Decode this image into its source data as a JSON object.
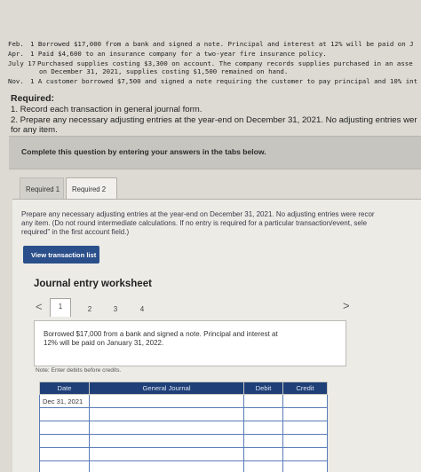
{
  "problem_lines": [
    {
      "label": "Feb.",
      "text": "1 Borrowed $17,000 from a bank and signed a note. Principal and interest at 12% will be paid on J"
    },
    {
      "label": "Apr.",
      "text": "1 Paid $4,600 to an insurance company for a two-year fire insurance policy."
    },
    {
      "label": "July 17",
      "text": "Purchased supplies costing $3,300 on account. The company records supplies purchased in an asse"
    },
    {
      "label": "",
      "text": "on December 31, 2021, supplies costing $1,500 remained on hand."
    },
    {
      "label": "Nov.",
      "text": "1 A customer borrowed $7,500 and signed a note requiring the customer to pay principal and 10% int"
    }
  ],
  "required": {
    "title": "Required:",
    "item1": "1. Record each transaction in general journal form.",
    "item2a": "2. Prepare any necessary adjusting entries at the year-end on December 31, 2021. No adjusting entries wer",
    "item2b": "for any item."
  },
  "banner": "Complete this question by entering your answers in the tabs below.",
  "tabs": [
    {
      "label": "Required 1"
    },
    {
      "label": "Required 2"
    }
  ],
  "instructions": [
    "Prepare any necessary adjusting entries at the year-end on December 31, 2021. No adjusting entries were recor",
    "any item. (Do not round intermediate calculations. If no entry is required for a particular transaction/event, sele",
    "required\" in the first account field.)"
  ],
  "view_button": "View transaction list",
  "worksheet": {
    "title": "Journal entry worksheet",
    "prev_arrow": "<",
    "next_arrow": ">",
    "pages": [
      "1",
      "2",
      "3",
      "4"
    ],
    "active_page": 1,
    "description": [
      "Borrowed $17,000 from a bank and signed a note. Principal and interest at",
      "12% will be paid on January 31, 2022."
    ],
    "note": "Note: Enter debits before credits.",
    "columns": {
      "date": "Date",
      "account": "General Journal",
      "debit": "Debit",
      "credit": "Credit"
    },
    "rows": [
      {
        "date": "Dec 31, 2021",
        "account": "",
        "debit": "",
        "credit": ""
      },
      {
        "date": "",
        "account": "",
        "debit": "",
        "credit": ""
      },
      {
        "date": "",
        "account": "",
        "debit": "",
        "credit": ""
      },
      {
        "date": "",
        "account": "",
        "debit": "",
        "credit": ""
      },
      {
        "date": "",
        "account": "",
        "debit": "",
        "credit": ""
      },
      {
        "date": "",
        "account": "",
        "debit": "",
        "credit": ""
      }
    ]
  },
  "colors": {
    "table_header": "#1e3f77",
    "button": "#2a4f8a",
    "row_border": "#5a7cb7"
  }
}
